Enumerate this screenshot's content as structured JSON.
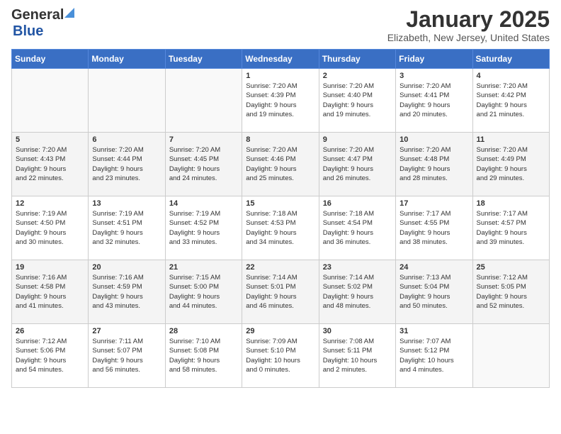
{
  "header": {
    "logo_general": "General",
    "logo_blue": "Blue",
    "month_title": "January 2025",
    "location": "Elizabeth, New Jersey, United States"
  },
  "weekdays": [
    "Sunday",
    "Monday",
    "Tuesday",
    "Wednesday",
    "Thursday",
    "Friday",
    "Saturday"
  ],
  "weeks": [
    [
      {
        "day": "",
        "info": ""
      },
      {
        "day": "",
        "info": ""
      },
      {
        "day": "",
        "info": ""
      },
      {
        "day": "1",
        "info": "Sunrise: 7:20 AM\nSunset: 4:39 PM\nDaylight: 9 hours\nand 19 minutes."
      },
      {
        "day": "2",
        "info": "Sunrise: 7:20 AM\nSunset: 4:40 PM\nDaylight: 9 hours\nand 19 minutes."
      },
      {
        "day": "3",
        "info": "Sunrise: 7:20 AM\nSunset: 4:41 PM\nDaylight: 9 hours\nand 20 minutes."
      },
      {
        "day": "4",
        "info": "Sunrise: 7:20 AM\nSunset: 4:42 PM\nDaylight: 9 hours\nand 21 minutes."
      }
    ],
    [
      {
        "day": "5",
        "info": "Sunrise: 7:20 AM\nSunset: 4:43 PM\nDaylight: 9 hours\nand 22 minutes."
      },
      {
        "day": "6",
        "info": "Sunrise: 7:20 AM\nSunset: 4:44 PM\nDaylight: 9 hours\nand 23 minutes."
      },
      {
        "day": "7",
        "info": "Sunrise: 7:20 AM\nSunset: 4:45 PM\nDaylight: 9 hours\nand 24 minutes."
      },
      {
        "day": "8",
        "info": "Sunrise: 7:20 AM\nSunset: 4:46 PM\nDaylight: 9 hours\nand 25 minutes."
      },
      {
        "day": "9",
        "info": "Sunrise: 7:20 AM\nSunset: 4:47 PM\nDaylight: 9 hours\nand 26 minutes."
      },
      {
        "day": "10",
        "info": "Sunrise: 7:20 AM\nSunset: 4:48 PM\nDaylight: 9 hours\nand 28 minutes."
      },
      {
        "day": "11",
        "info": "Sunrise: 7:20 AM\nSunset: 4:49 PM\nDaylight: 9 hours\nand 29 minutes."
      }
    ],
    [
      {
        "day": "12",
        "info": "Sunrise: 7:19 AM\nSunset: 4:50 PM\nDaylight: 9 hours\nand 30 minutes."
      },
      {
        "day": "13",
        "info": "Sunrise: 7:19 AM\nSunset: 4:51 PM\nDaylight: 9 hours\nand 32 minutes."
      },
      {
        "day": "14",
        "info": "Sunrise: 7:19 AM\nSunset: 4:52 PM\nDaylight: 9 hours\nand 33 minutes."
      },
      {
        "day": "15",
        "info": "Sunrise: 7:18 AM\nSunset: 4:53 PM\nDaylight: 9 hours\nand 34 minutes."
      },
      {
        "day": "16",
        "info": "Sunrise: 7:18 AM\nSunset: 4:54 PM\nDaylight: 9 hours\nand 36 minutes."
      },
      {
        "day": "17",
        "info": "Sunrise: 7:17 AM\nSunset: 4:55 PM\nDaylight: 9 hours\nand 38 minutes."
      },
      {
        "day": "18",
        "info": "Sunrise: 7:17 AM\nSunset: 4:57 PM\nDaylight: 9 hours\nand 39 minutes."
      }
    ],
    [
      {
        "day": "19",
        "info": "Sunrise: 7:16 AM\nSunset: 4:58 PM\nDaylight: 9 hours\nand 41 minutes."
      },
      {
        "day": "20",
        "info": "Sunrise: 7:16 AM\nSunset: 4:59 PM\nDaylight: 9 hours\nand 43 minutes."
      },
      {
        "day": "21",
        "info": "Sunrise: 7:15 AM\nSunset: 5:00 PM\nDaylight: 9 hours\nand 44 minutes."
      },
      {
        "day": "22",
        "info": "Sunrise: 7:14 AM\nSunset: 5:01 PM\nDaylight: 9 hours\nand 46 minutes."
      },
      {
        "day": "23",
        "info": "Sunrise: 7:14 AM\nSunset: 5:02 PM\nDaylight: 9 hours\nand 48 minutes."
      },
      {
        "day": "24",
        "info": "Sunrise: 7:13 AM\nSunset: 5:04 PM\nDaylight: 9 hours\nand 50 minutes."
      },
      {
        "day": "25",
        "info": "Sunrise: 7:12 AM\nSunset: 5:05 PM\nDaylight: 9 hours\nand 52 minutes."
      }
    ],
    [
      {
        "day": "26",
        "info": "Sunrise: 7:12 AM\nSunset: 5:06 PM\nDaylight: 9 hours\nand 54 minutes."
      },
      {
        "day": "27",
        "info": "Sunrise: 7:11 AM\nSunset: 5:07 PM\nDaylight: 9 hours\nand 56 minutes."
      },
      {
        "day": "28",
        "info": "Sunrise: 7:10 AM\nSunset: 5:08 PM\nDaylight: 9 hours\nand 58 minutes."
      },
      {
        "day": "29",
        "info": "Sunrise: 7:09 AM\nSunset: 5:10 PM\nDaylight: 10 hours\nand 0 minutes."
      },
      {
        "day": "30",
        "info": "Sunrise: 7:08 AM\nSunset: 5:11 PM\nDaylight: 10 hours\nand 2 minutes."
      },
      {
        "day": "31",
        "info": "Sunrise: 7:07 AM\nSunset: 5:12 PM\nDaylight: 10 hours\nand 4 minutes."
      },
      {
        "day": "",
        "info": ""
      }
    ]
  ]
}
